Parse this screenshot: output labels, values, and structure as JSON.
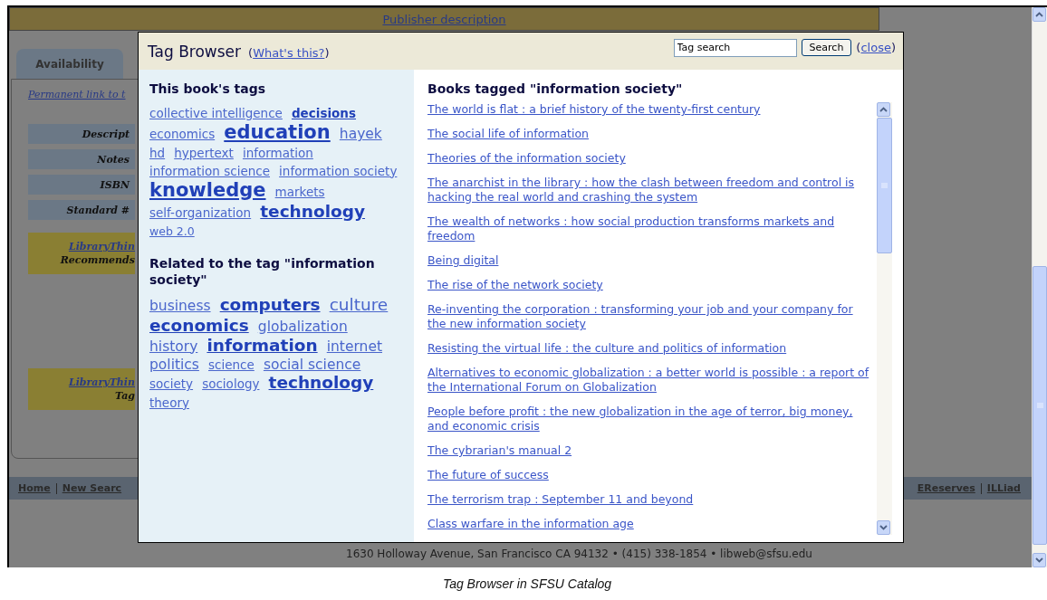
{
  "page": {
    "publisher_link": "Publisher description",
    "availability_tab": "Availability",
    "permanent_link": "Permanent link to t",
    "fields": [
      "Descript",
      "Notes",
      "ISBN",
      "Standard #"
    ],
    "librarything_boxes": [
      {
        "link": "LibraryThin",
        "label": "Recommends"
      },
      {
        "link": "LibraryThin",
        "label": "Tag"
      }
    ],
    "nav_left": [
      "Home",
      "New Searc"
    ],
    "nav_right": [
      "EReserves",
      "ILLiad"
    ],
    "address": "1630 Holloway Avenue, San Francisco CA 94132 • (415) 338-1854 • libweb@sfsu.edu"
  },
  "tag_browser": {
    "title": "Tag Browser",
    "help": {
      "open": "(",
      "link": "What's this?",
      "close": ")"
    },
    "search": {
      "value": "Tag search",
      "button": "Search"
    },
    "close": {
      "open": "(",
      "link": "close",
      "close": ")"
    },
    "book_tags": {
      "heading": "This book's tags",
      "tags": [
        {
          "label": "collective intelligence",
          "kind": "small",
          "bold": false
        },
        {
          "label": "decisions",
          "kind": "small",
          "bold": true
        },
        {
          "label": "economics",
          "kind": "small",
          "bold": false
        },
        {
          "label": "education",
          "kind": "huge",
          "bold": true
        },
        {
          "label": "hayek",
          "kind": "medium",
          "bold": false
        },
        {
          "label": "hd",
          "kind": "small",
          "bold": false
        },
        {
          "label": "hypertext",
          "kind": "small",
          "bold": false
        },
        {
          "label": "information",
          "kind": "small",
          "bold": false
        },
        {
          "label": "information science",
          "kind": "small",
          "bold": false
        },
        {
          "label": "information society",
          "kind": "small",
          "bold": false
        },
        {
          "label": "knowledge",
          "kind": "huge",
          "bold": true
        },
        {
          "label": "markets",
          "kind": "small",
          "bold": false
        },
        {
          "label": "self-organization",
          "kind": "small",
          "bold": false
        },
        {
          "label": "technology",
          "kind": "large",
          "bold": true
        },
        {
          "label": "web 2.0",
          "kind": "tiny",
          "bold": false
        }
      ]
    },
    "related": {
      "heading": "Related to the tag \"information society\"",
      "tags": [
        {
          "label": "business",
          "kind": "medium",
          "bold": false
        },
        {
          "label": "computers",
          "kind": "large",
          "bold": true
        },
        {
          "label": "culture",
          "kind": "large",
          "bold": false
        },
        {
          "label": "economics",
          "kind": "large",
          "bold": true
        },
        {
          "label": "globalization",
          "kind": "medium",
          "bold": false
        },
        {
          "label": "history",
          "kind": "medium",
          "bold": false
        },
        {
          "label": "information",
          "kind": "large",
          "bold": true
        },
        {
          "label": "internet",
          "kind": "medium",
          "bold": false
        },
        {
          "label": "politics",
          "kind": "medium",
          "bold": false
        },
        {
          "label": "science",
          "kind": "small",
          "bold": false
        },
        {
          "label": "social science",
          "kind": "medium",
          "bold": false
        },
        {
          "label": "society",
          "kind": "small",
          "bold": false
        },
        {
          "label": "sociology",
          "kind": "small",
          "bold": false
        },
        {
          "label": "technology",
          "kind": "large",
          "bold": true
        },
        {
          "label": "theory",
          "kind": "small",
          "bold": false
        }
      ]
    },
    "books": {
      "heading": "Books tagged \"information society\"",
      "titles": [
        "The world is flat : a brief history of the twenty-first century",
        "The social life of information",
        "Theories of the information society",
        "The anarchist in the library : how the clash between freedom and control is hacking the real world and crashing the system",
        "The wealth of networks : how social production transforms markets and freedom",
        "Being digital",
        "The rise of the network society",
        "Re-inventing the corporation : transforming your job and your company for the new information society",
        "Resisting the virtual life : the culture and politics of information",
        "Alternatives to economic globalization : a better world is possible : a report of the International Forum on Globalization",
        "People before profit : the new globalization in the age of terror, big money, and economic crisis",
        "The cybrarian's manual 2",
        "The future of success",
        "The terrorism trap : September 11 and beyond",
        "Class warfare in the information age"
      ]
    }
  },
  "caption": "Tag Browser in SFSU Catalog"
}
